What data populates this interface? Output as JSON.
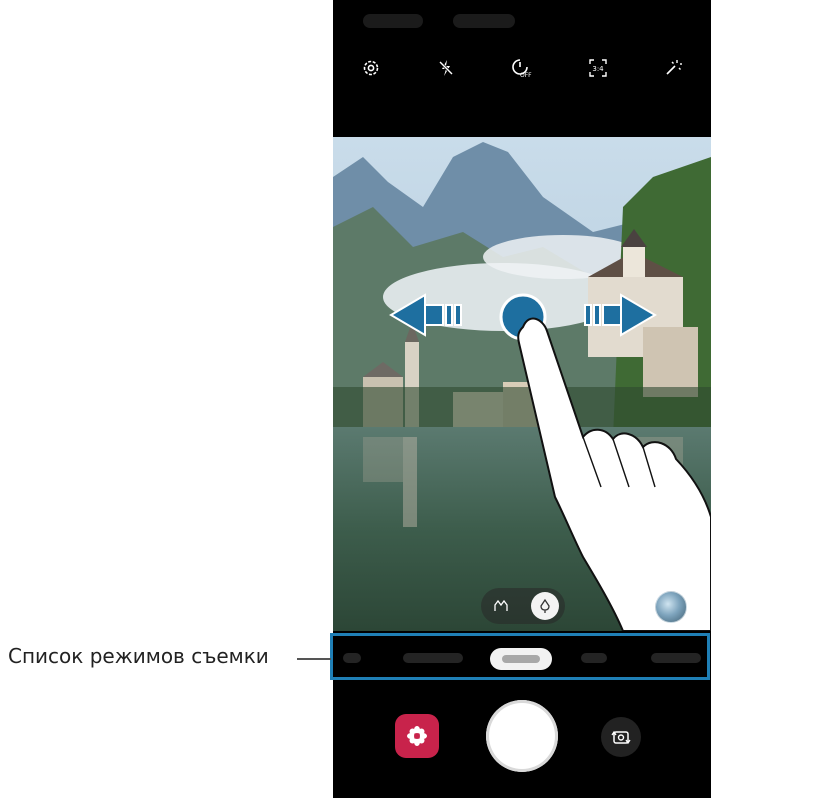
{
  "annotation": {
    "callout_label": "Список режимов съемки",
    "highlight_color": "#1f7fb6"
  },
  "camera": {
    "toolbar": {
      "icons": [
        "settings-icon",
        "flash-off-icon",
        "timer-off-icon",
        "aspect-ratio-icon",
        "filters-icon"
      ],
      "timer_label": "OFF",
      "aspect_ratio_label": "3:4"
    },
    "viewfinder": {
      "lens_toggle": {
        "icons": [
          "wide-angle-icon",
          "single-lens-icon"
        ],
        "selected": "single-lens-icon"
      },
      "effect_button_icon": "effect-preview-icon"
    },
    "mode_list": {
      "selected_mode_index": 2
    },
    "bottom_controls": {
      "gallery_icon": "bixby-vision-flower-icon",
      "shutter_icon": "shutter-icon",
      "switch_icon": "switch-camera-icon"
    }
  },
  "gesture": {
    "icon": "swipe-gesture-icon",
    "arrows": [
      "arrow-left-icon",
      "arrow-right-icon"
    ]
  },
  "colors": {
    "accent_blue": "#1e6fa0",
    "gallery_red": "#c8234b"
  }
}
